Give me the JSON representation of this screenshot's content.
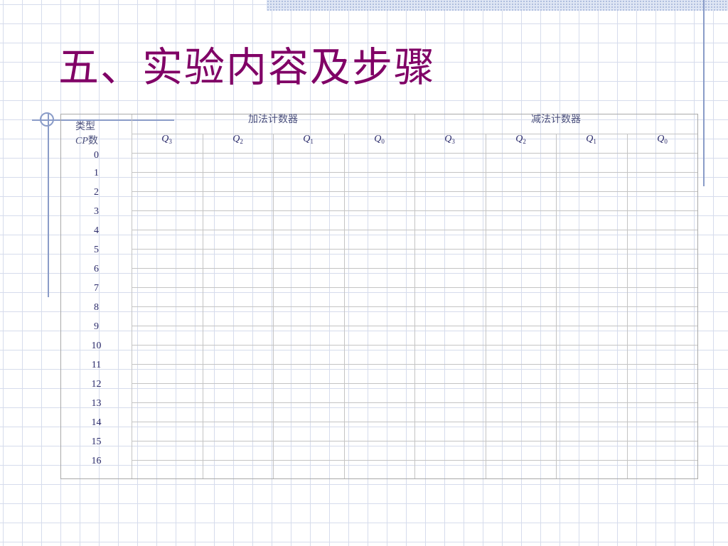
{
  "slide": {
    "title": "五、实验内容及步骤"
  },
  "table": {
    "corner": {
      "top": "类型",
      "bottom_italic": "CP",
      "bottom_rest": "数"
    },
    "groups": [
      {
        "label": "加法计数器"
      },
      {
        "label": "减法计数器"
      }
    ],
    "columns": [
      {
        "base": "Q",
        "sub": "3"
      },
      {
        "base": "Q",
        "sub": "2"
      },
      {
        "base": "Q",
        "sub": "1"
      },
      {
        "base": "Q",
        "sub": "0"
      },
      {
        "base": "Q",
        "sub": "3"
      },
      {
        "base": "Q",
        "sub": "2"
      },
      {
        "base": "Q",
        "sub": "1"
      },
      {
        "base": "Q",
        "sub": "0"
      }
    ],
    "rows": [
      "0",
      "1",
      "2",
      "3",
      "4",
      "5",
      "6",
      "7",
      "8",
      "9",
      "10",
      "11",
      "12",
      "13",
      "14",
      "15",
      "16"
    ]
  },
  "colors": {
    "title": "#800066",
    "grid_background": "#d6dcec",
    "accent_lines": "#8a9cc8"
  }
}
